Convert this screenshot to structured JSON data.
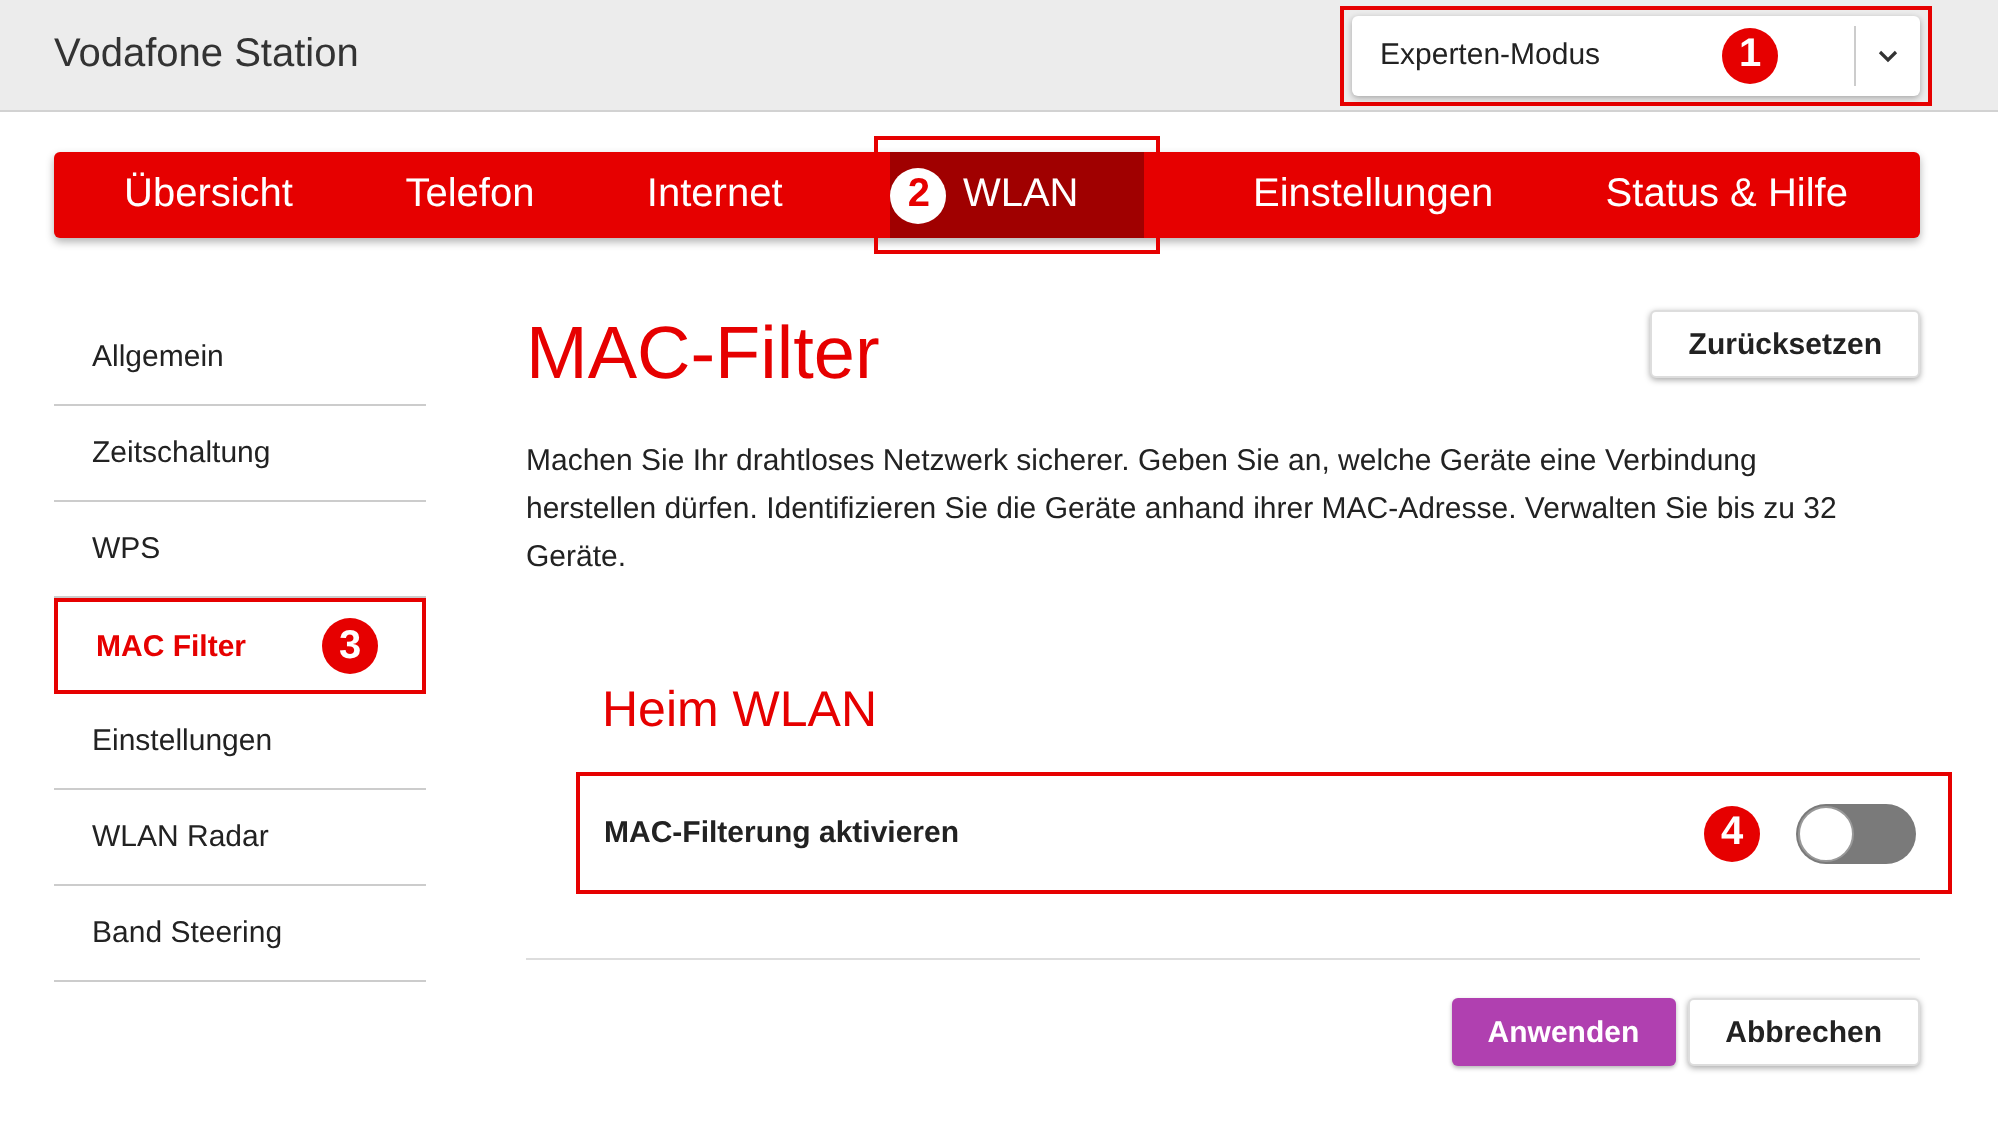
{
  "header": {
    "title": "Vodafone Station",
    "mode_select": {
      "value": "Experten-Modus",
      "callout": "1"
    }
  },
  "tabs": [
    {
      "label": "Übersicht",
      "selected": false
    },
    {
      "label": "Telefon",
      "selected": false
    },
    {
      "label": "Internet",
      "selected": false
    },
    {
      "label": "WLAN",
      "selected": true,
      "callout": "2"
    },
    {
      "label": "Einstellungen",
      "selected": false
    },
    {
      "label": "Status & Hilfe",
      "selected": false
    }
  ],
  "sidebar": {
    "items": [
      {
        "label": "Allgemein",
        "selected": false
      },
      {
        "label": "Zeitschaltung",
        "selected": false
      },
      {
        "label": "WPS",
        "selected": false
      },
      {
        "label": "MAC Filter",
        "selected": true,
        "callout": "3"
      },
      {
        "label": "Einstellungen",
        "selected": false
      },
      {
        "label": "WLAN Radar",
        "selected": false
      },
      {
        "label": "Band Steering",
        "selected": false
      }
    ]
  },
  "page": {
    "title": "MAC-Filter",
    "reset_button": "Zurücksetzen",
    "description": "Machen Sie Ihr drahtloses Netzwerk sicherer. Geben Sie an, welche Geräte eine Verbindung herstellen dürfen. Identifizieren Sie die Geräte anhand ihrer MAC-Adresse. Verwalten Sie bis zu 32 Geräte.",
    "section_title": "Heim WLAN",
    "toggle": {
      "label": "MAC-Filterung aktivieren",
      "on": false,
      "callout": "4"
    },
    "buttons": [
      {
        "label": "Anwenden",
        "kind": "primary"
      },
      {
        "label": "Abbrechen",
        "kind": "secondary"
      }
    ]
  }
}
